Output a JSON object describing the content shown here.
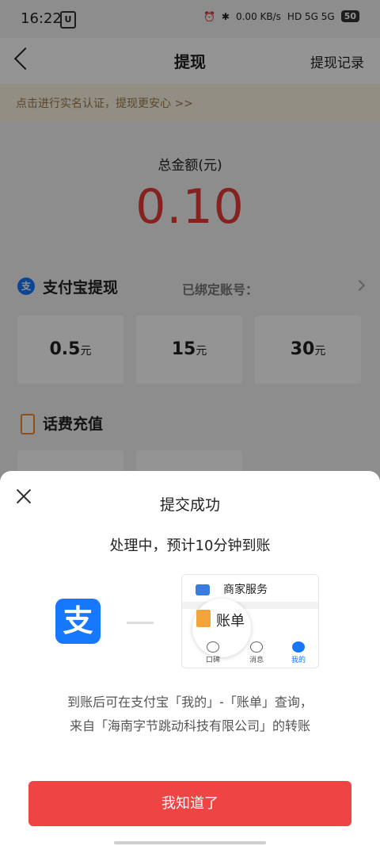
{
  "status": {
    "time": "16:22",
    "u_icon": "U",
    "speed": "0.00 KB/s",
    "net": "HD 5G 5G",
    "battery": "50"
  },
  "header": {
    "title": "提现",
    "records": "提现记录"
  },
  "banner": {
    "text": "点击进行实名认证，提现更安心 >>"
  },
  "summary": {
    "label": "总金额(元)",
    "amount": "0.10"
  },
  "alipay": {
    "icon": "支",
    "title": "支付宝提现",
    "bound": "已绑定账号：",
    "options": [
      {
        "value": "0.5",
        "unit": "元"
      },
      {
        "value": "15",
        "unit": "元"
      },
      {
        "value": "30",
        "unit": "元"
      }
    ]
  },
  "phone": {
    "title": "话费充值"
  },
  "dialog": {
    "title": "提交成功",
    "processing": "处理中，预计10分钟到账",
    "alipay_logo": "支",
    "mock": {
      "service": "商家服务",
      "bill": "账单",
      "tabs": [
        "口碑",
        "消息",
        "我的"
      ]
    },
    "note_line1": "到账后可在支付宝「我的」-「账单」查询，",
    "note_line2": "来自「海南字节跳动科技有限公司」的转账",
    "button": "我知道了"
  }
}
